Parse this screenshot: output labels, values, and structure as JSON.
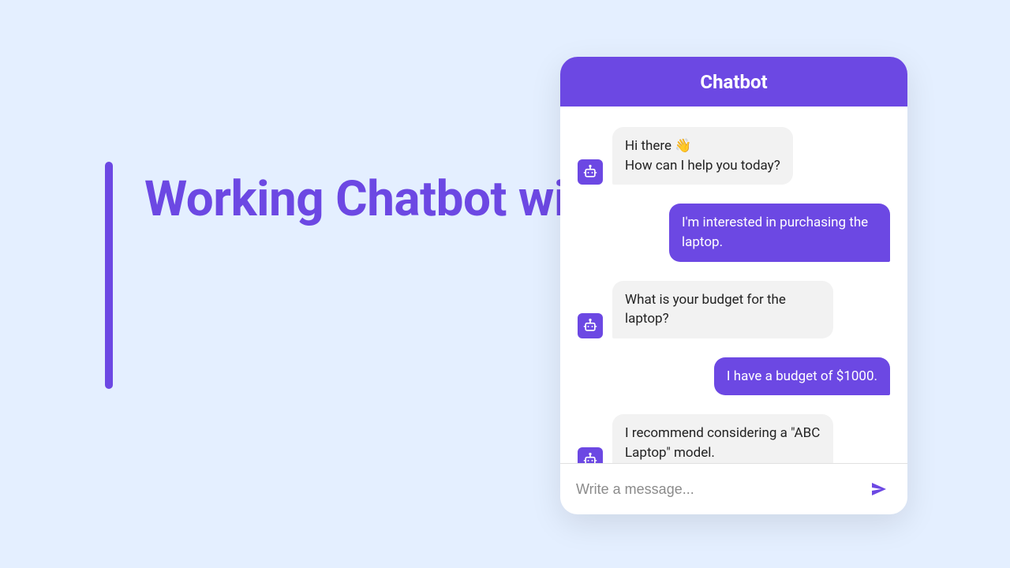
{
  "headline": "Working Chatbot with JavaScript",
  "chat": {
    "header_title": "Chatbot",
    "messages": [
      {
        "from": "bot",
        "text": "Hi there 👋\nHow can I help you today?"
      },
      {
        "from": "user",
        "text": "I'm interested in purchasing the laptop."
      },
      {
        "from": "bot",
        "text": "What is your budget for the laptop?"
      },
      {
        "from": "user",
        "text": "I have a budget of $1000."
      },
      {
        "from": "bot",
        "text": "I recommend considering a \"ABC Laptop\" model."
      }
    ],
    "input_placeholder": "Write a message..."
  },
  "icons": {
    "bot_avatar": "robot-icon",
    "send": "send-icon"
  },
  "colors": {
    "accent": "#6c48e3",
    "page_bg": "#e4efff",
    "bot_bubble": "#f2f2f2"
  }
}
